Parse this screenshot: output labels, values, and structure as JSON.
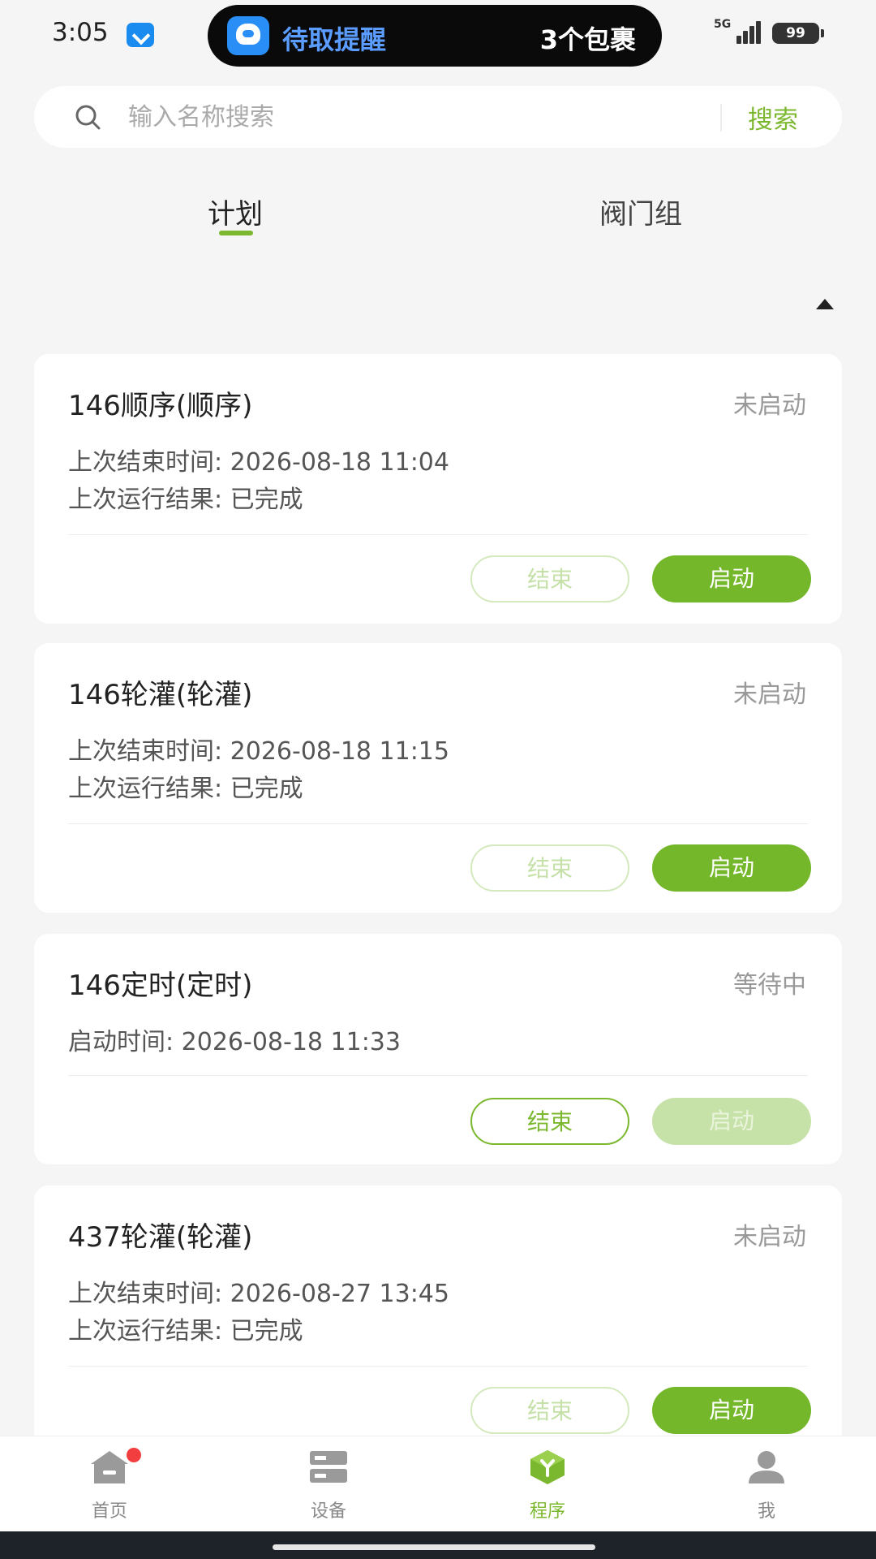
{
  "status_bar": {
    "time": "3:05",
    "network": "5G",
    "battery": "99"
  },
  "notification": {
    "title": "待取提醒",
    "count": "3个包裹"
  },
  "search": {
    "placeholder": "输入名称搜索",
    "button": "搜索"
  },
  "tabs": [
    {
      "label": "计划",
      "active": true
    },
    {
      "label": "阀门组",
      "active": false
    }
  ],
  "cards": [
    {
      "title": "146顺序(顺序)",
      "status": "未启动",
      "lines": [
        "上次结束时间: 2026-08-18 11:04",
        "上次运行结果: 已完成"
      ],
      "end_label": "结束",
      "start_label": "启动",
      "end_enabled": false,
      "start_enabled": true
    },
    {
      "title": "146轮灌(轮灌)",
      "status": "未启动",
      "lines": [
        "上次结束时间: 2026-08-18 11:15",
        "上次运行结果: 已完成"
      ],
      "end_label": "结束",
      "start_label": "启动",
      "end_enabled": false,
      "start_enabled": true
    },
    {
      "title": "146定时(定时)",
      "status": "等待中",
      "lines": [
        "启动时间: 2026-08-18 11:33"
      ],
      "end_label": "结束",
      "start_label": "启动",
      "end_enabled": true,
      "start_enabled": false
    },
    {
      "title": "437轮灌(轮灌)",
      "status": "未启动",
      "lines": [
        "上次结束时间: 2026-08-27 13:45",
        "上次运行结果: 已完成"
      ],
      "end_label": "结束",
      "start_label": "启动",
      "end_enabled": false,
      "start_enabled": true
    }
  ],
  "bottom_nav": [
    {
      "label": "首页",
      "icon": "home-icon",
      "active": false,
      "badge": true
    },
    {
      "label": "设备",
      "icon": "device-icon",
      "active": false,
      "badge": false
    },
    {
      "label": "程序",
      "icon": "program-icon",
      "active": true,
      "badge": false
    },
    {
      "label": "我",
      "icon": "user-icon",
      "active": false,
      "badge": false
    }
  ],
  "colors": {
    "accent": "#7cb82f",
    "background": "#f5f5f5",
    "badge": "#f23e3e"
  }
}
